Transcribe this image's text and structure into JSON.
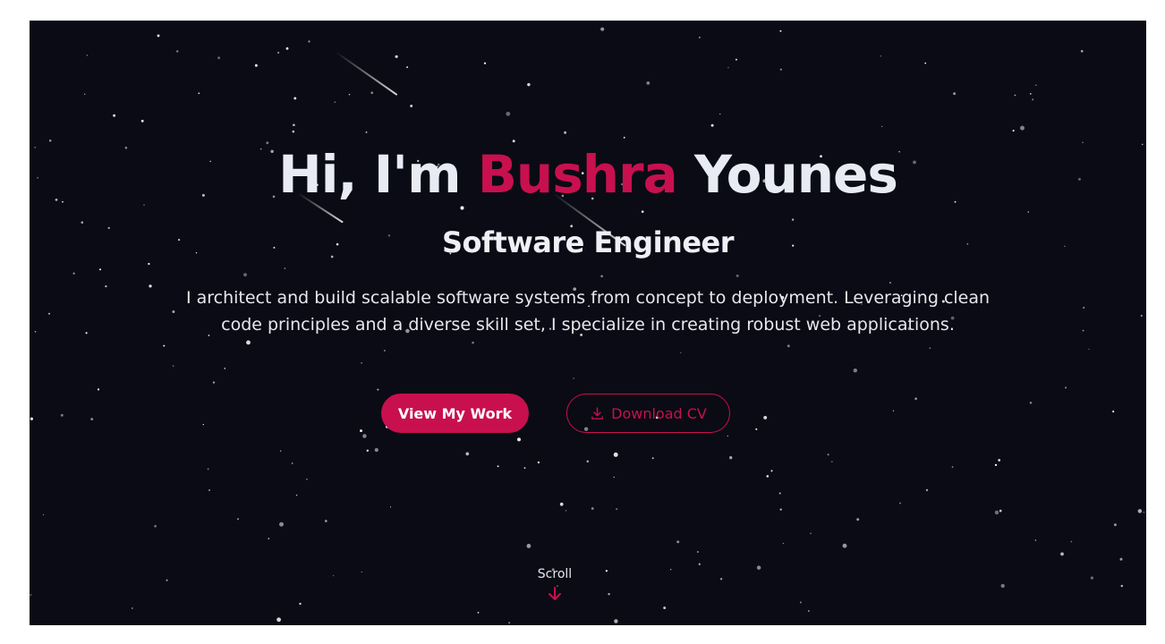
{
  "hero": {
    "greeting": "Hi, I'm ",
    "first_name": "Bushra",
    "last_name": " Younes",
    "role": "Software Engineer",
    "bio_line1": "I architect and build scalable software systems from concept to deployment. Leveraging clean",
    "bio_line2": "code principles and a diverse skill set, I specialize in creating robust web applications."
  },
  "actions": {
    "primary_label": "View My Work",
    "secondary_label": "Download CV",
    "secondary_icon": "download-icon"
  },
  "scroll": {
    "label": "Scroll",
    "icon": "arrow-down-icon"
  },
  "colors": {
    "background": "#0a0b14",
    "accent": "#c8104f",
    "text": "#e8ebf3"
  }
}
